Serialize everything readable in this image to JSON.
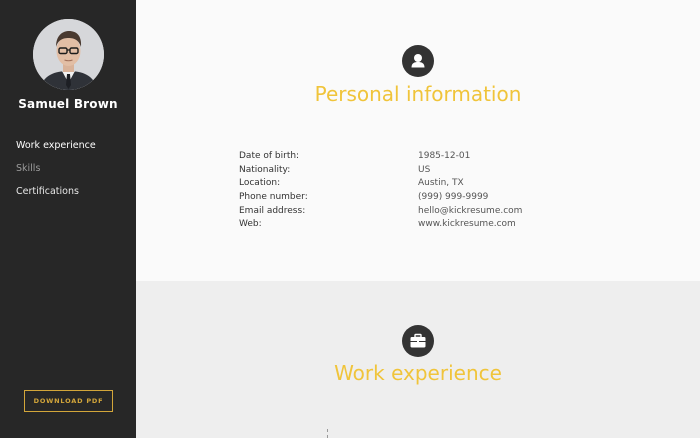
{
  "sidebar": {
    "name": "Samuel Brown",
    "avatar_icon": "person-photo",
    "nav": [
      {
        "label": "Work experience",
        "state": "active"
      },
      {
        "label": "Skills",
        "state": "muted"
      },
      {
        "label": "Certifications",
        "state": "plain"
      }
    ],
    "download_label": "DOWNLOAD PDF"
  },
  "personal": {
    "icon": "user-icon",
    "title": "Personal information",
    "rows": [
      {
        "label": "Date of birth:",
        "value": "1985-12-01"
      },
      {
        "label": "Nationality:",
        "value": "US"
      },
      {
        "label": "Location:",
        "value": "Austin, TX"
      },
      {
        "label": "Phone number:",
        "value": "(999) 999-9999"
      },
      {
        "label": "Email address:",
        "value": "hello@kickresume.com"
      },
      {
        "label": "Web:",
        "value": "www.kickresume.com"
      }
    ]
  },
  "work": {
    "icon": "briefcase-icon",
    "title": "Work experience"
  },
  "colors": {
    "accent": "#f0c43a",
    "sidebar_bg": "#272727",
    "button_border": "#d3a63a",
    "icon_bg": "#333333"
  }
}
